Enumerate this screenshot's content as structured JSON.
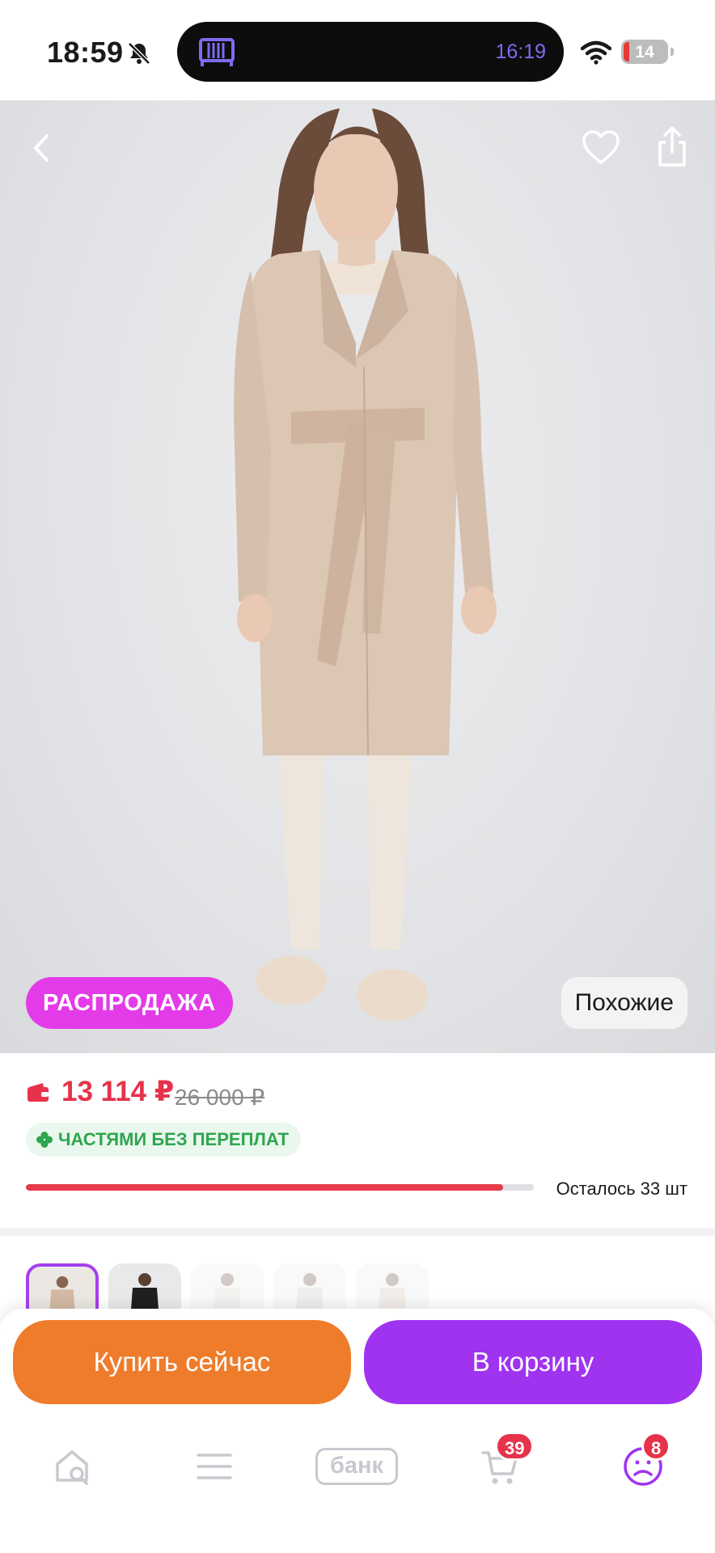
{
  "status_bar": {
    "time": "18:59",
    "island_time": "16:19",
    "battery": "14",
    "icons": [
      "bell-slash-icon",
      "crib-icon",
      "wifi-icon",
      "battery-icon"
    ]
  },
  "hero": {
    "icons": [
      "back-icon",
      "heart-icon",
      "share-icon"
    ],
    "sale_label": "РАСПРОДАЖА",
    "similar_label": "Похожие"
  },
  "price": {
    "current": "13 114 ₽",
    "old": "26 000 ₽",
    "installment_label": "ЧАСТЯМИ БЕЗ ПЕРЕПЛАТ",
    "stock_label": "Осталось 33 шт",
    "stock_fraction": 0.94
  },
  "variants": {
    "count": 5,
    "selected_index": 0
  },
  "actions": {
    "buy_now_label": "Купить сейчас",
    "add_to_cart_label": "В корзину"
  },
  "tabbar": {
    "bank_label": "банк",
    "cart_badge": "39",
    "profile_badge": "8",
    "icons": [
      "home-search-icon",
      "menu-icon",
      "cart-icon",
      "profile-icon"
    ]
  },
  "colors": {
    "price_red": "#e6324b",
    "sale_pink": "#e43be8",
    "buy_orange": "#ef7c2b",
    "cart_purple": "#a033f0",
    "installment_green": "#2ea64f"
  }
}
